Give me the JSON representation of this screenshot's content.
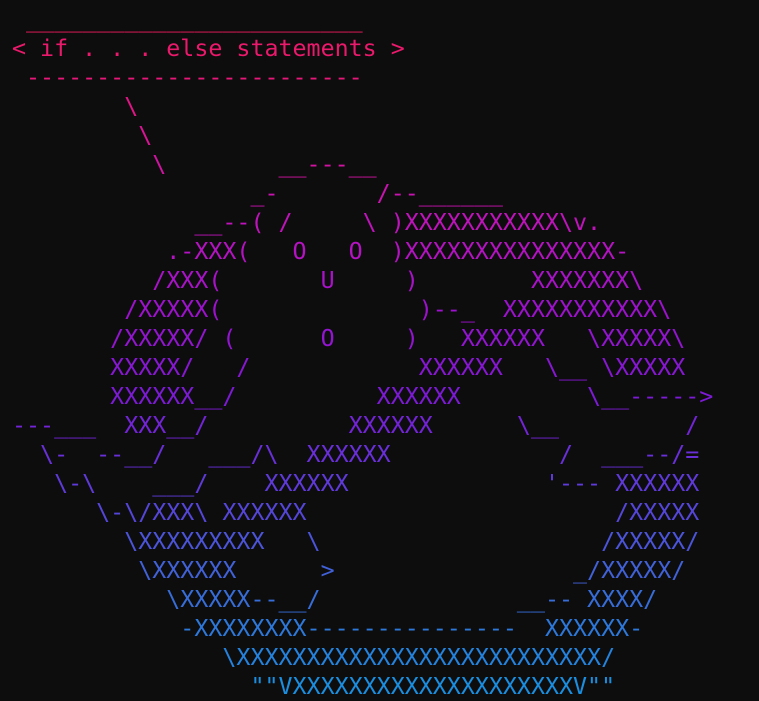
{
  "colors": {
    "background": "#0d0d0d",
    "gradient": [
      "#f01b5e",
      "#e0148a",
      "#c413b8",
      "#a011cf",
      "#7b1ad6",
      "#5b3fdb",
      "#3a6ad8",
      "#1a8ee0"
    ]
  },
  "art": {
    "lines": [
      " ________________________",
      "< if . . . else statements >",
      " ------------------------",
      "        \\",
      "         \\",
      "          \\        __---__",
      "                 _-       /--______",
      "             __--( /     \\ )XXXXXXXXXXX\\v.",
      "           .-XXX(   O   O  )XXXXXXXXXXXXXXX-",
      "          /XXX(       U     )        XXXXXXX\\",
      "        /XXXXX(              )--_  XXXXXXXXXXX\\",
      "       /XXXXX/ (      O     )   XXXXXX   \\XXXXX\\",
      "       XXXXX/   /            XXXXXX   \\__ \\XXXXX",
      "       XXXXXX__/          XXXXXX         \\__----->",
      "---___  XXX__/          XXXXXX      \\__         /",
      "  \\-  --__/   ___/\\  XXXXXX            /  ___--/=",
      "   \\-\\    ___/    XXXXXX              '--- XXXXXX",
      "      \\-\\/XXX\\ XXXXXX                      /XXXXX",
      "        \\XXXXXXXXX   \\                    /XXXXX/",
      "         \\XXXXXX      >                 _/XXXXX/",
      "           \\XXXXX--__/              __-- XXXX/",
      "            -XXXXXXXX---------------  XXXXXX-",
      "               \\XXXXXXXXXXXXXXXXXXXXXXXXXX/",
      "                 \"\"VXXXXXXXXXXXXXXXXXXXXV\"\""
    ]
  }
}
